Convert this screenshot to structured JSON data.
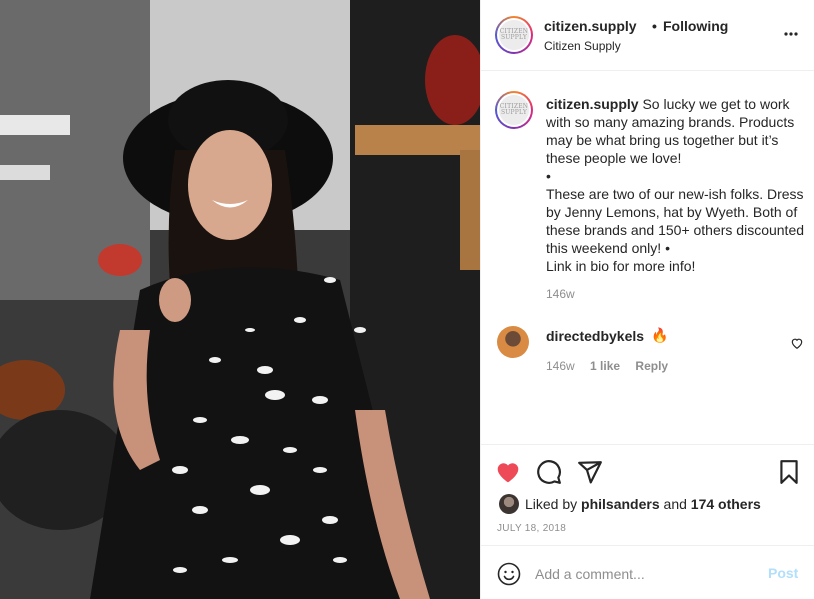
{
  "header": {
    "username": "citizen.supply",
    "dot": "•",
    "follow_status": "Following",
    "subtitle": "Citizen Supply",
    "avatar_logo_text": "CITIZEN SUPPLY",
    "more_icon": "more-horizontal-icon"
  },
  "caption": {
    "username": "citizen.supply",
    "text": "So lucky we get to work with so many amazing brands. Products may be what bring us together but it’s these people we love!\n•\nThese are two of our new-ish folks. Dress by Jenny Lemons, hat by Wyeth. Both of these brands and 150+ others discounted this weekend only! •\nLink in bio for more info!",
    "time": "146w"
  },
  "comment": {
    "username": "directedbykels",
    "text": "🔥",
    "time": "146w",
    "likes": "1 like",
    "reply": "Reply"
  },
  "actions": {
    "like_icon": "heart-filled-icon",
    "comment_icon": "comment-icon",
    "share_icon": "share-icon",
    "save_icon": "bookmark-icon",
    "liked_prefix": "Liked by",
    "liked_user": "philsanders",
    "liked_and": "and",
    "liked_others": "174 others",
    "date": "JULY 18, 2018"
  },
  "add_comment": {
    "placeholder": "Add a comment...",
    "post_label": "Post"
  },
  "colors": {
    "heart_red": "#ed4956",
    "post_blue_disabled": "#b2dffc",
    "meta_gray": "#8e8e8e"
  }
}
